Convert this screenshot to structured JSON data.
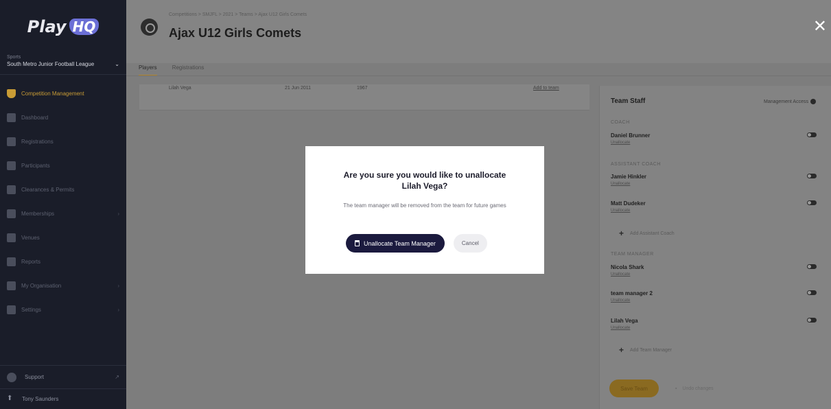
{
  "sidebar": {
    "logo_text": "Play",
    "logo_badge": "HQ",
    "org_label": "Sports",
    "org_name": "South Metro Junior Football League",
    "items": [
      {
        "label": "Competition Management",
        "icon": "trophy-icon",
        "active": true
      },
      {
        "label": "Dashboard",
        "icon": "dashboard-icon"
      },
      {
        "label": "Registrations",
        "icon": "registrations-icon"
      },
      {
        "label": "Participants",
        "icon": "participants-icon"
      },
      {
        "label": "Clearances & Permits",
        "icon": "transfer-icon"
      },
      {
        "label": "Memberships",
        "icon": "membership-icon"
      },
      {
        "label": "Venues",
        "icon": "venue-icon"
      },
      {
        "label": "Reports",
        "icon": "reports-icon"
      },
      {
        "label": "My Organisation",
        "icon": "organisation-icon"
      },
      {
        "label": "Settings",
        "icon": "settings-icon"
      }
    ],
    "support_label": "Support",
    "user_name": "Tony Saunders"
  },
  "header": {
    "breadcrumb": "Competitions > SMJFL > 2021 > Teams > Ajax U12 Girls Comets",
    "title": "Ajax U12 Girls Comets",
    "tabs": [
      {
        "label": "Players",
        "active": true
      },
      {
        "label": "Registrations"
      }
    ]
  },
  "table": {
    "row": {
      "name": "Lilah Vega",
      "date": "21 Jun 2011",
      "number": "1967",
      "action": "Add to team"
    }
  },
  "staff": {
    "title": "Team Staff",
    "management_label": "Management Access",
    "sections": [
      {
        "role": "COACH",
        "people": [
          {
            "name": "Daniel Brunner",
            "action": "Unallocate"
          }
        ],
        "add_label": ""
      },
      {
        "role": "ASSISTANT COACH",
        "people": [
          {
            "name": "Jamie Hinkler",
            "action": "Unallocate"
          },
          {
            "name": "Matt Dudeker",
            "action": "Unallocate"
          }
        ],
        "add_label": "Add Assistant Coach"
      },
      {
        "role": "TEAM MANAGER",
        "people": [
          {
            "name": "Nicola Shark",
            "action": "Unallocate"
          },
          {
            "name": "team manager 2",
            "action": "Unallocate"
          },
          {
            "name": "Lilah Vega",
            "action": "Unallocate"
          }
        ],
        "add_label": "Add Team Manager"
      }
    ],
    "save_label": "Save Team",
    "undo_label": "Undo changes"
  },
  "modal": {
    "title_line1": "Are you sure you would like to unallocate",
    "title_line2": "Lilah Vega?",
    "body": "The team manager will be removed from the team for future games",
    "confirm_label": "Unallocate Team Manager",
    "cancel_label": "Cancel"
  },
  "colors": {
    "sidebar_bg": "#1a1d29",
    "accent_gold": "#c99c35",
    "primary_button": "#1b1a3e",
    "overlay": "#7d7d7d"
  }
}
